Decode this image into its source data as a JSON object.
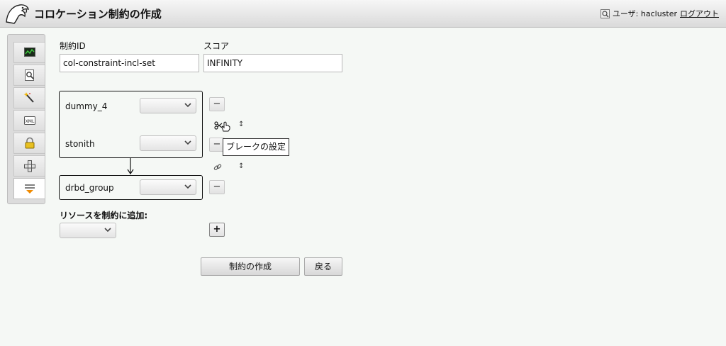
{
  "header": {
    "title": "コロケーション制約の作成",
    "user_label": "ユーザ: hacluster",
    "logout": "ログアウト"
  },
  "sidebar": {
    "items": [
      {
        "icon": "monitor-icon"
      },
      {
        "icon": "search-document-icon"
      },
      {
        "icon": "wand-icon"
      },
      {
        "icon": "xml-icon"
      },
      {
        "icon": "lock-icon"
      },
      {
        "icon": "network-icon"
      },
      {
        "icon": "constraints-icon",
        "active": true
      }
    ]
  },
  "form": {
    "constraint_id_label": "制約ID",
    "constraint_id_value": "col-constraint-incl-set",
    "score_label": "スコア",
    "score_value": "INFINITY"
  },
  "sets": [
    {
      "resources": [
        {
          "name": "dummy_4",
          "role": ""
        },
        {
          "name": "stonith",
          "role": ""
        }
      ]
    },
    {
      "resources": [
        {
          "name": "drbd_group",
          "role": ""
        }
      ]
    }
  ],
  "tooltip": "ブレークの設定",
  "add_resource": {
    "label": "リソースを制約に追加:",
    "selected": "",
    "add_button": "+"
  },
  "actions": {
    "create": "制約の作成",
    "back": "戻る"
  },
  "symbols": {
    "remove": "−",
    "reorder": "↕"
  }
}
